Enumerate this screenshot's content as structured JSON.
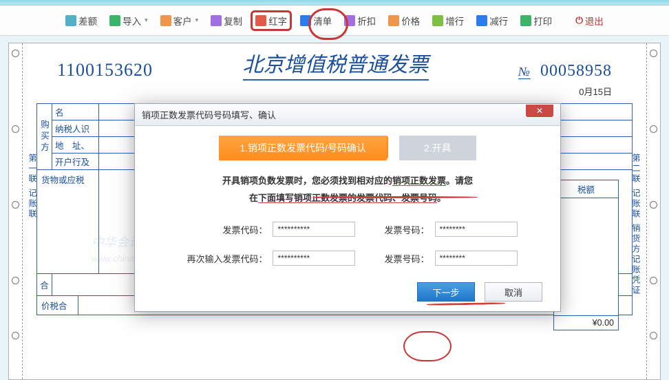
{
  "toolbar": {
    "items": [
      {
        "label": "差额"
      },
      {
        "label": "导入"
      },
      {
        "label": "客户"
      },
      {
        "label": "复制"
      },
      {
        "label": "红字"
      },
      {
        "label": "清单"
      },
      {
        "label": "折扣"
      },
      {
        "label": "价格"
      },
      {
        "label": "增行"
      },
      {
        "label": "减行"
      },
      {
        "label": "打印"
      }
    ],
    "exit": "退出"
  },
  "invoice": {
    "code": "1100153620",
    "title": "北京增值税普通发票",
    "no_label": "№",
    "no": "00058958",
    "date_tail": "0月15日",
    "buyer_v": "购买方",
    "buyer": {
      "name_lbl": "名",
      "taxid_lbl": "纳税人识",
      "addr_lbl": "地　址、",
      "bank_lbl": "开户行及"
    },
    "goods_header": "货物或应税",
    "tax_header": "税额",
    "he_label": "合",
    "pricesum_label": "价税合",
    "amount_zero": "¥0.00",
    "side_left": "第一联 记账联",
    "side_right": "第二联 记账联 销货方记账凭证"
  },
  "dialog": {
    "title": "销项正数发票代码号码填写、确认",
    "step1": "1.销项正数发票代码/号码确认",
    "step2": "2.开具",
    "note1_a": "开具销项负数发票时，您必须找到相对应的",
    "note1_b": "销项正数发票",
    "note1_c": "。请您",
    "note2_a": "在",
    "note2_b": "下面填写销项正数发票的发票代码、发票号码",
    "note2_c": "。",
    "f_code": "发票代码：",
    "f_no": "发票号码：",
    "f_code2": "再次输入发票代码：",
    "f_no2": "发票号码：",
    "placeholder_code": "**********",
    "placeholder_no": "********",
    "btn_next": "下一步",
    "btn_cancel": "取消"
  },
  "watermark": {
    "brand": "中华会计网校",
    "url": "www.chinaacc.com"
  }
}
